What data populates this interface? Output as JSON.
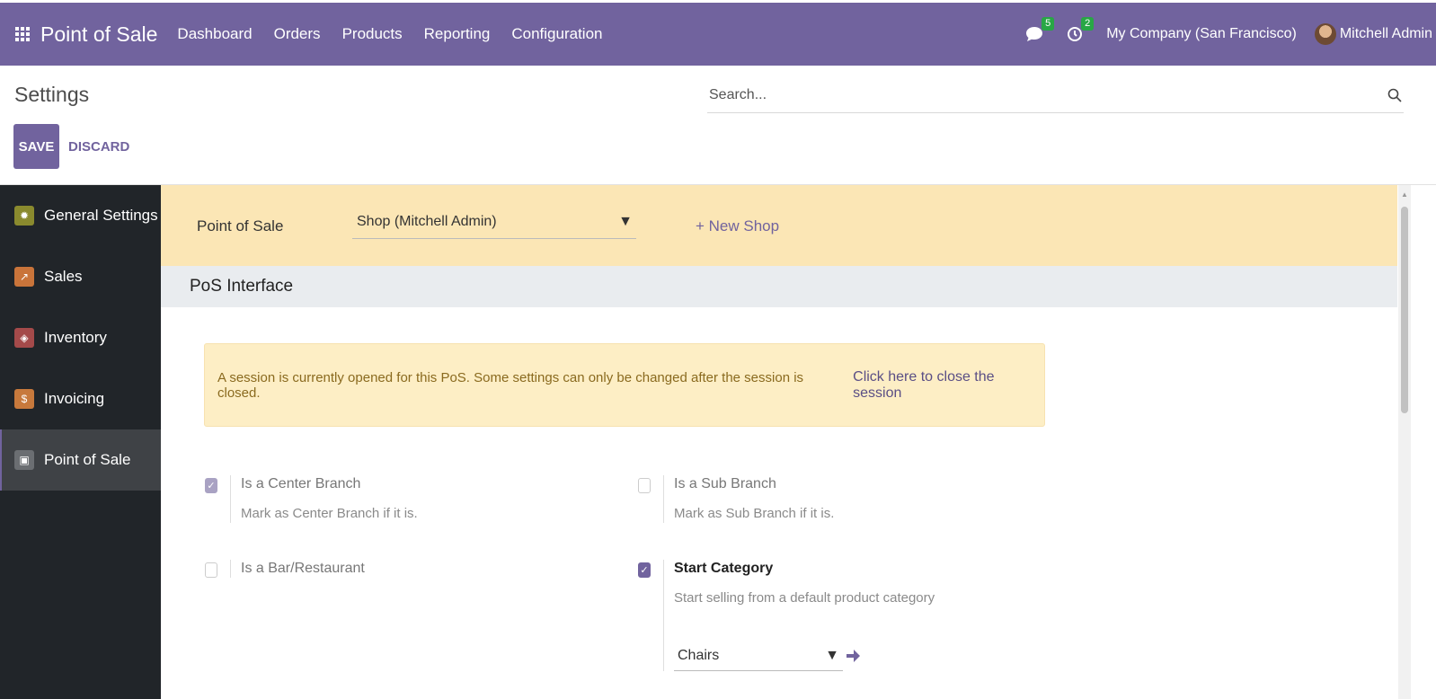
{
  "navbar": {
    "app_name": "Point of Sale",
    "menus": [
      "Dashboard",
      "Orders",
      "Products",
      "Reporting",
      "Configuration"
    ],
    "messages_count": "5",
    "activities_count": "2",
    "company": "My Company (San Francisco)",
    "user": "Mitchell Admin"
  },
  "control_panel": {
    "title": "Settings",
    "search_placeholder": "Search...",
    "save_label": "SAVE",
    "discard_label": "DISCARD"
  },
  "sidebar": {
    "items": [
      {
        "label": "General Settings",
        "icon": "gear-icon",
        "color": "#6c6b2a"
      },
      {
        "label": "Sales",
        "icon": "chart-icon",
        "color": "#c9743a"
      },
      {
        "label": "Inventory",
        "icon": "box-icon",
        "color": "#a44a4a"
      },
      {
        "label": "Invoicing",
        "icon": "invoice-icon",
        "color": "#c7793c"
      },
      {
        "label": "Point of Sale",
        "icon": "store-icon",
        "color": "#6b6e72"
      }
    ],
    "active_index": 4
  },
  "shop": {
    "label": "Point of Sale",
    "selected": "Shop (Mitchell Admin)",
    "new_shop_label": "+ New Shop"
  },
  "section": {
    "title": "PoS Interface"
  },
  "alert": {
    "message": "A session is currently opened for this PoS. Some settings can only be changed after the session is closed.",
    "link": "Click here to close the session"
  },
  "settings": {
    "center_branch": {
      "title": "Is a Center Branch",
      "description": "Mark as Center Branch if it is.",
      "checked": true
    },
    "sub_branch": {
      "title": "Is a Sub Branch",
      "description": "Mark as Sub Branch if it is.",
      "checked": false
    },
    "bar_restaurant": {
      "title": "Is a Bar/Restaurant",
      "checked": false
    },
    "start_category": {
      "title": "Start Category",
      "description": "Start selling from a default product category",
      "checked": true,
      "category": "Chairs"
    }
  },
  "colors": {
    "brand": "#71639e",
    "sidebar_bg": "#212529",
    "shop_bar_bg": "#fbe6b5"
  }
}
